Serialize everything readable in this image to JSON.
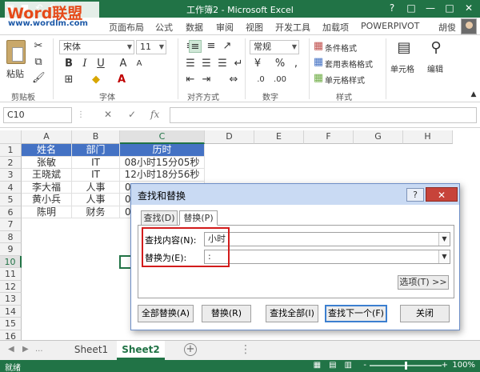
{
  "titlebar": {
    "title": "工作簿2 - Microsoft Excel",
    "qat_icons": [
      "excel-logo-icon",
      "save-icon",
      "undo-icon",
      "redo-icon",
      "customize-qat-icon"
    ],
    "window_buttons": [
      "?",
      "□",
      "—",
      "□",
      "✕"
    ]
  },
  "watermark": {
    "logo": "Word联盟",
    "url": "www.wordlm.com"
  },
  "ribbon_tabs": [
    "页面布局",
    "公式",
    "数据",
    "审阅",
    "视图",
    "开发工具",
    "加载项",
    "POWERPIVOT"
  ],
  "user": "胡俊",
  "ribbon": {
    "paste_label": "粘贴",
    "clipboard_label": "剪贴板",
    "font_name": "宋体",
    "font_size": "11",
    "font_label": "字体",
    "align_label": "对齐方式",
    "number_format": "常规",
    "number_label": "数字",
    "conditional_format": "条件格式",
    "table_format": "套用表格格式",
    "cell_style": "单元格样式",
    "style_label": "样式",
    "cells_label": "单元格",
    "edit_label": "编辑",
    "bold": "B",
    "italic": "I",
    "underline": "U",
    "currency": "¥",
    "percent": "%",
    "comma": ","
  },
  "formula_bar": {
    "cell_ref": "C10",
    "fx": "fx",
    "cancel": "✕",
    "enter": "✓",
    "value": ""
  },
  "grid": {
    "columns": [
      "A",
      "B",
      "C",
      "D",
      "E",
      "F",
      "G",
      "H"
    ],
    "selected_column": "C",
    "rows": [
      "1",
      "2",
      "3",
      "4",
      "5",
      "6",
      "7",
      "8",
      "9",
      "10",
      "11",
      "12",
      "13",
      "14",
      "15",
      "16"
    ],
    "selected_row": "10",
    "data": [
      [
        "姓名",
        "部门",
        "历时"
      ],
      [
        "张敏",
        "IT",
        "08小时15分05秒"
      ],
      [
        "王晓斌",
        "IT",
        "12小时18分56秒"
      ],
      [
        "李大福",
        "人事",
        "0"
      ],
      [
        "黄小兵",
        "人事",
        "0"
      ],
      [
        "陈明",
        "财务",
        "0"
      ]
    ]
  },
  "sheets": {
    "tabs": [
      "Sheet1",
      "Sheet2"
    ],
    "active": "Sheet2",
    "nav": [
      "◀",
      "▶",
      "..."
    ],
    "add": "+"
  },
  "status": {
    "ready": "就绪",
    "zoom": "100%",
    "minus": "-",
    "plus": "+"
  },
  "dialog": {
    "title": "查找和替换",
    "help": "?",
    "close": "✕",
    "tabs": [
      "查找(D)",
      "替换(P)"
    ],
    "active_tab": "替换(P)",
    "find_label": "查找内容(N):",
    "find_value": "小时",
    "replace_label": "替换为(E):",
    "replace_value": ":",
    "options_button": "选项(T) >>",
    "buttons": {
      "replace_all": "全部替换(A)",
      "replace": "替换(R)",
      "find_all": "查找全部(I)",
      "find_next": "查找下一个(F)",
      "close": "关闭"
    }
  },
  "colors": {
    "accent": "#217346",
    "header_fill": "#4472c4",
    "dialog_title": "#c9daf3",
    "highlight_box": "#d21b1b"
  }
}
